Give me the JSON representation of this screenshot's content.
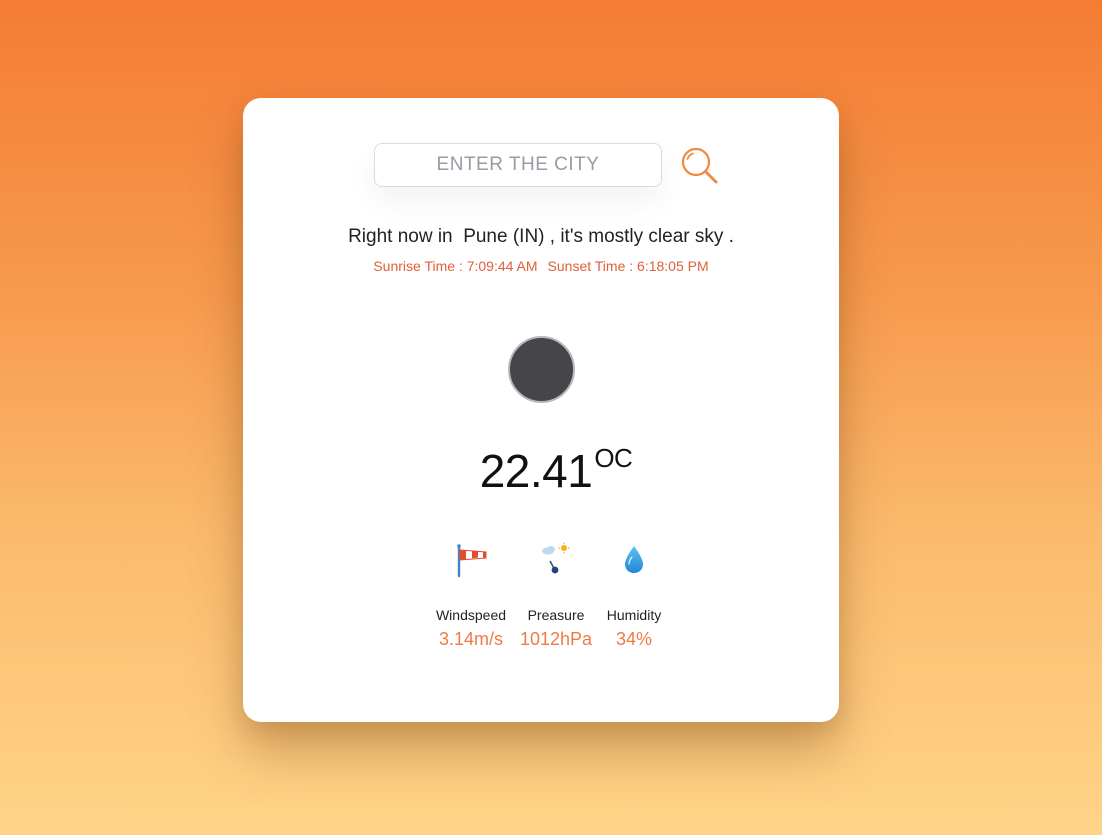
{
  "search": {
    "placeholder": "ENTER THE CITY"
  },
  "summary": {
    "prefix": "Right now in",
    "city": "Pune (IN)",
    "suffix": ", it's mostly clear sky ."
  },
  "sun": {
    "sunrise": "Sunrise Time : 7:09:44 AM",
    "sunset": "Sunset Time : 6:18:05 PM"
  },
  "temperature": {
    "value": "22.41",
    "unit": "OC"
  },
  "stats": [
    {
      "icon": "windsock-icon",
      "label": "Windspeed",
      "value": "3.14m/s"
    },
    {
      "icon": "pressure-gauge-icon",
      "label": "Preasure",
      "value": "1012hPa"
    },
    {
      "icon": "water-drop-icon",
      "label": "Humidity",
      "value": "34%"
    }
  ],
  "colors": {
    "accent": "#ef7a45",
    "sun_text": "#e0603a",
    "gradient_top": "#f47c33",
    "gradient_bottom": "#ffd488"
  }
}
